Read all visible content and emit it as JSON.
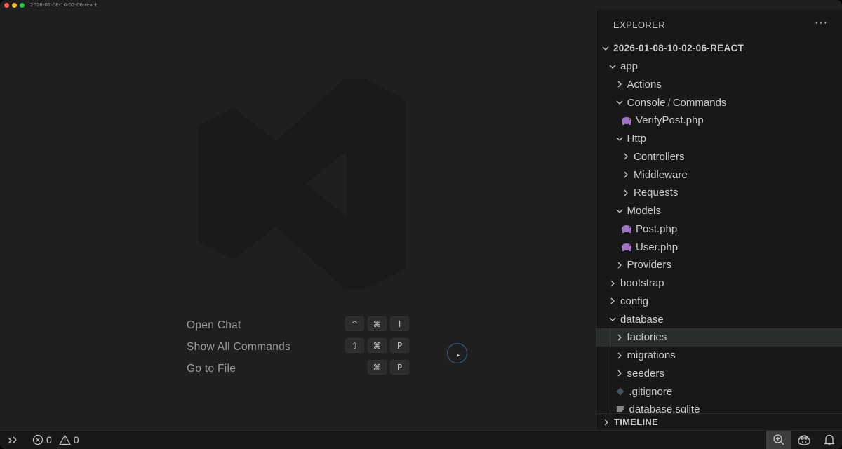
{
  "window": {
    "title": "2026-01-08-10-02-06-react",
    "traffic_colors": [
      "#ff5f57",
      "#febc2e",
      "#28c840"
    ]
  },
  "editor": {
    "watermark_icon": "vscode-logo-icon",
    "shortcuts": [
      {
        "label": "Open Chat",
        "keys": [
          "^",
          "⌘",
          "I"
        ]
      },
      {
        "label": "Show All Commands",
        "keys": [
          "⇧",
          "⌘",
          "P"
        ]
      },
      {
        "label": "Go to File",
        "keys": [
          "⌘",
          "P"
        ]
      }
    ]
  },
  "explorer": {
    "header": "EXPLORER",
    "more_icon": "ellipsis-icon",
    "root": "2026-01-08-10-02-06-REACT",
    "items": [
      {
        "label": "app",
        "type": "folder",
        "open": true,
        "depth": 1
      },
      {
        "label": "Actions",
        "type": "folder",
        "open": false,
        "depth": 2
      },
      {
        "label": "Console",
        "label2": "Commands",
        "type": "folder",
        "open": true,
        "depth": 2
      },
      {
        "label": "VerifyPost.php",
        "type": "php",
        "depth": 3
      },
      {
        "label": "Http",
        "type": "folder",
        "open": true,
        "depth": 2
      },
      {
        "label": "Controllers",
        "type": "folder",
        "open": false,
        "depth": 3
      },
      {
        "label": "Middleware",
        "type": "folder",
        "open": false,
        "depth": 3
      },
      {
        "label": "Requests",
        "type": "folder",
        "open": false,
        "depth": 3
      },
      {
        "label": "Models",
        "type": "folder",
        "open": true,
        "depth": 2
      },
      {
        "label": "Post.php",
        "type": "php",
        "depth": 3
      },
      {
        "label": "User.php",
        "type": "php",
        "depth": 3
      },
      {
        "label": "Providers",
        "type": "folder",
        "open": false,
        "depth": 2
      },
      {
        "label": "bootstrap",
        "type": "folder",
        "open": false,
        "depth": 1
      },
      {
        "label": "config",
        "type": "folder",
        "open": false,
        "depth": 1
      },
      {
        "label": "database",
        "type": "folder",
        "open": true,
        "depth": 1
      },
      {
        "label": "factories",
        "type": "folder",
        "open": false,
        "depth": 2,
        "selected": true
      },
      {
        "label": "migrations",
        "type": "folder",
        "open": false,
        "depth": 2
      },
      {
        "label": "seeders",
        "type": "folder",
        "open": false,
        "depth": 2
      },
      {
        "label": ".gitignore",
        "type": "git",
        "depth": 2
      },
      {
        "label": "database.sqlite",
        "type": "file",
        "depth": 2
      }
    ],
    "timeline": "TIMELINE"
  },
  "statusbar": {
    "errors": "0",
    "warnings": "0",
    "right_icons": [
      "zoom-icon",
      "copilot-icon",
      "bell-icon"
    ]
  },
  "colors": {
    "php_icon": "#a074c4",
    "accent_ring": "#3a5d8a"
  }
}
